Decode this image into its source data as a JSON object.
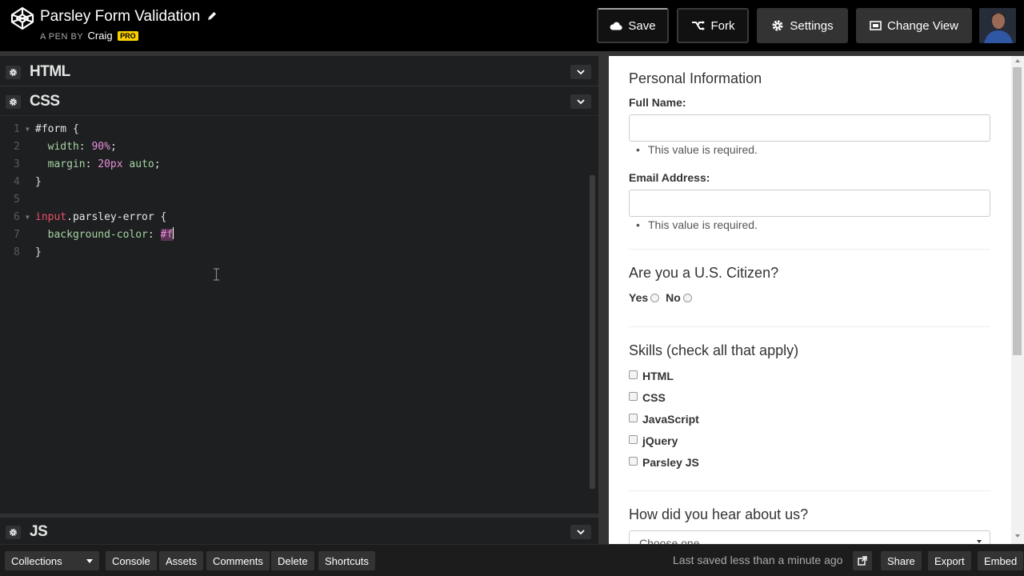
{
  "app": {
    "pen_title": "Parsley Form Validation",
    "byline_prefix": "A PEN BY",
    "author": "Craig",
    "pro_badge": "PRO"
  },
  "header": {
    "save_label": "Save",
    "fork_label": "Fork",
    "settings_label": "Settings",
    "change_view_label": "Change View"
  },
  "editor": {
    "panels": {
      "html": "HTML",
      "css": "CSS",
      "js": "JS"
    },
    "line_numbers": [
      "1",
      "2",
      "3",
      "4",
      "5",
      "6",
      "7",
      "8"
    ],
    "code": {
      "l1_selector": "#form",
      "l1_brace": " {",
      "l2_indent": "  ",
      "l2_prop": "width",
      "l2_colon": ": ",
      "l2_value": "90%",
      "l2_semi": ";",
      "l3_indent": "  ",
      "l3_prop": "margin",
      "l3_colon": ": ",
      "l3_v1": "20px",
      "l3_v2": " auto",
      "l3_semi": ";",
      "l4_brace": "}",
      "l6_tag": "input",
      "l6_class": ".parsley-error",
      "l6_brace": " {",
      "l7_indent": "  ",
      "l7_prop": "background-color",
      "l7_colon": ": ",
      "l7_value": "#f",
      "l8_brace": "}"
    }
  },
  "preview": {
    "personal_legend": "Personal Information",
    "full_name_label": "Full Name:",
    "full_name_error": "This value is required.",
    "email_label": "Email Address:",
    "email_error": "This value is required.",
    "citizen_legend": "Are you a U.S. Citizen?",
    "radio_yes": "Yes",
    "radio_no": "No",
    "skills_legend": "Skills (check all that apply)",
    "skills": [
      "HTML",
      "CSS",
      "JavaScript",
      "jQuery",
      "Parsley JS"
    ],
    "hear_legend": "How did you hear about us?",
    "select_value": "Choose one"
  },
  "footer": {
    "collections_label": "Collections",
    "console_label": "Console",
    "assets_label": "Assets",
    "comments_label": "Comments",
    "delete_label": "Delete",
    "shortcuts_label": "Shortcuts",
    "saved_status": "Last saved less than a minute ago",
    "share_label": "Share",
    "export_label": "Export",
    "embed_label": "Embed"
  }
}
